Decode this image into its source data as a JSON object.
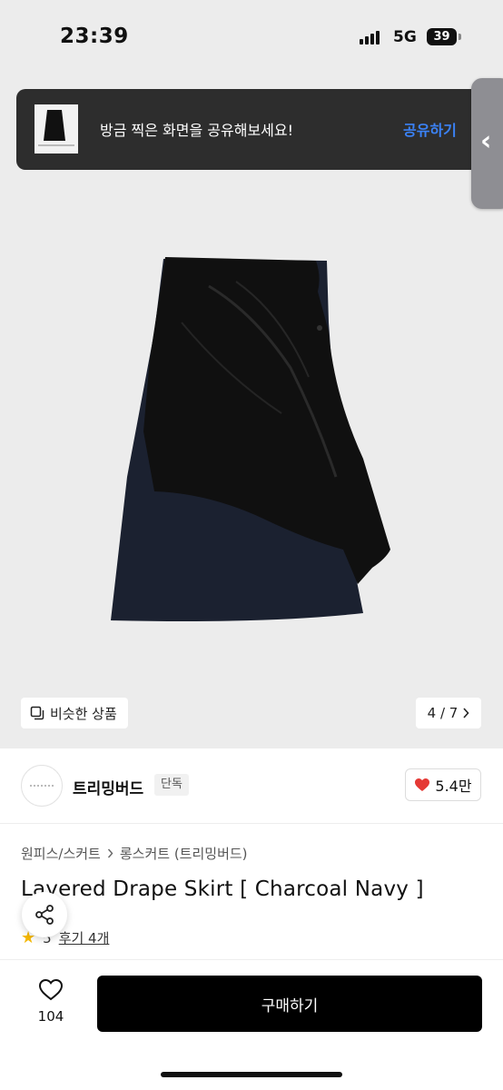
{
  "status_bar": {
    "time": "23:39",
    "network": "5G",
    "battery": "39"
  },
  "share_toast": {
    "message": "방금 찍은 화면을 공유해보세요!",
    "action_label": "공유하기",
    "handle_icon": "chevron-left-icon"
  },
  "gallery": {
    "similar_label": "비슷한 상품",
    "page_indicator": "4 / 7",
    "current_page": 4,
    "total_pages": 7
  },
  "brand": {
    "name": "트리밍버드",
    "tag": "단독",
    "likes": "5.4만"
  },
  "breadcrumb": {
    "category": "원피스/스커트",
    "subcategory": "롱스커트 (트리밍버드)"
  },
  "product": {
    "title": "Layered Drape Skirt [ Charcoal Navy ]",
    "rating": "5",
    "reviews_label": "후기 4개"
  },
  "bottom_bar": {
    "wishlist_count": "104",
    "buy_label": "구매하기"
  },
  "colors": {
    "accent_blue": "#3b82f6",
    "heart_red": "#e53935",
    "star_yellow": "#f5b800",
    "button_black": "#000000"
  }
}
